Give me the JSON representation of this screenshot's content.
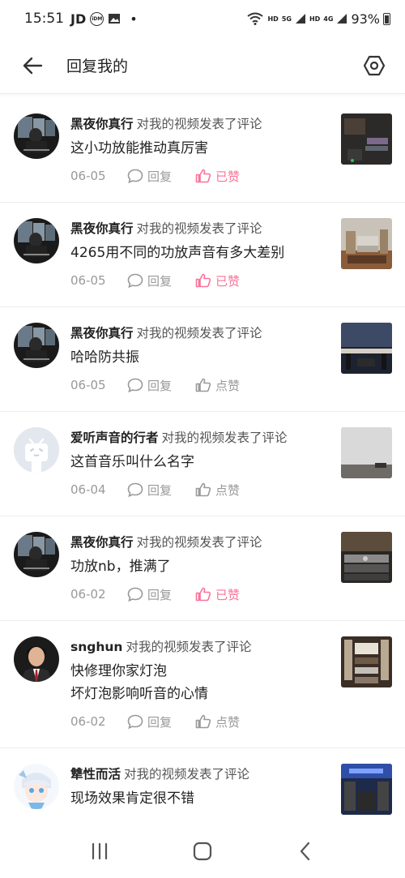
{
  "status_bar": {
    "time": "15:51",
    "left_icons": [
      "JD",
      "iDM"
    ],
    "network": "HD",
    "network2": "5G",
    "network3": "HD",
    "network4": "4G",
    "battery": "93%"
  },
  "header": {
    "title": "回复我的"
  },
  "comments": [
    {
      "user": "黑夜你真行",
      "action": "对我的视频发表了评论",
      "text": "这小功放能推动真厉害",
      "date": "06-05",
      "reply_label": "回复",
      "like_label": "已赞",
      "liked": true
    },
    {
      "user": "黑夜你真行",
      "action": "对我的视频发表了评论",
      "text": "4265用不同的功放声音有多大差别",
      "date": "06-05",
      "reply_label": "回复",
      "like_label": "已赞",
      "liked": true
    },
    {
      "user": "黑夜你真行",
      "action": "对我的视频发表了评论",
      "text": "哈哈防共振",
      "date": "06-05",
      "reply_label": "回复",
      "like_label": "点赞",
      "liked": false
    },
    {
      "user": "爱听声音的行者",
      "action": "对我的视频发表了评论",
      "text": "这首音乐叫什么名字",
      "date": "06-04",
      "reply_label": "回复",
      "like_label": "点赞",
      "liked": false
    },
    {
      "user": "黑夜你真行",
      "action": "对我的视频发表了评论",
      "text": "功放nb，推满了",
      "date": "06-02",
      "reply_label": "回复",
      "like_label": "已赞",
      "liked": true
    },
    {
      "user": "snghun",
      "action": "对我的视频发表了评论",
      "text": "快修理你家灯泡",
      "text2": "坏灯泡影响听音的心情",
      "date": "06-02",
      "reply_label": "回复",
      "like_label": "点赞",
      "liked": false
    },
    {
      "user": "犨性而活",
      "action": "对我的视频发表了评论",
      "text": "现场效果肯定很不错"
    }
  ],
  "colors": {
    "accent_pink": "#fb7299",
    "meta_gray": "#999999"
  }
}
